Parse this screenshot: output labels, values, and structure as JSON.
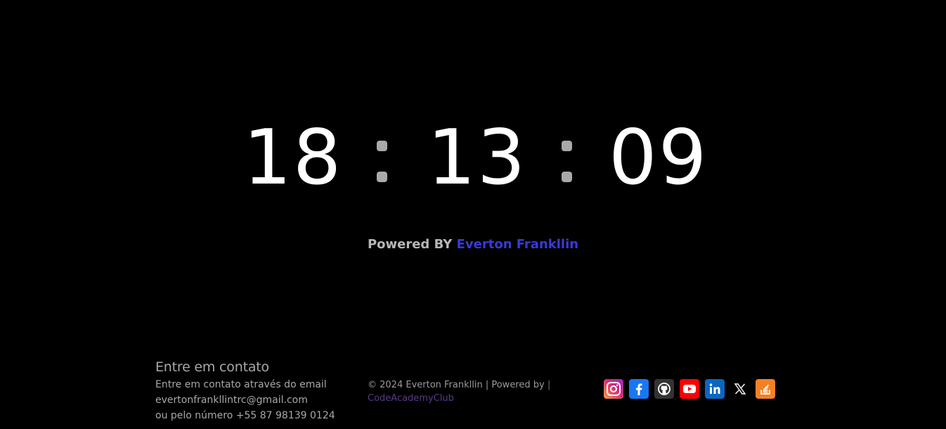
{
  "clock": {
    "hours": "18",
    "minutes": "13",
    "seconds": "09",
    "digit_color": "#ffffff",
    "separator_color": "#a9a9a9"
  },
  "powered": {
    "prefix": "Powered BY ",
    "author_link": "Everton Frankllin",
    "link_color": "#3a3ad6"
  },
  "footer": {
    "contact_title": "Entre em contato",
    "contact_line1": "Entre em contato através do email",
    "contact_email": "evertonfrankllintrc@gmail.com",
    "contact_phone": "ou pelo número +55 87 98139 0124",
    "copyright": "© 2024 Everton Frankllin | Powered by",
    "separator": " |",
    "club_link": "CodeAcademyClub",
    "club_color": "#5a3a8a"
  },
  "socials": [
    {
      "icon": "instagram-icon",
      "color": "#c13584"
    },
    {
      "icon": "facebook-icon",
      "color": "#1877f2"
    },
    {
      "icon": "github-icon",
      "color": "#333333"
    },
    {
      "icon": "youtube-icon",
      "color": "#ff0000"
    },
    {
      "icon": "linkedin-icon",
      "color": "#0a66c2"
    },
    {
      "icon": "x-icon",
      "color": "#000000"
    },
    {
      "icon": "stackoverflow-icon",
      "color": "#f48024"
    }
  ]
}
